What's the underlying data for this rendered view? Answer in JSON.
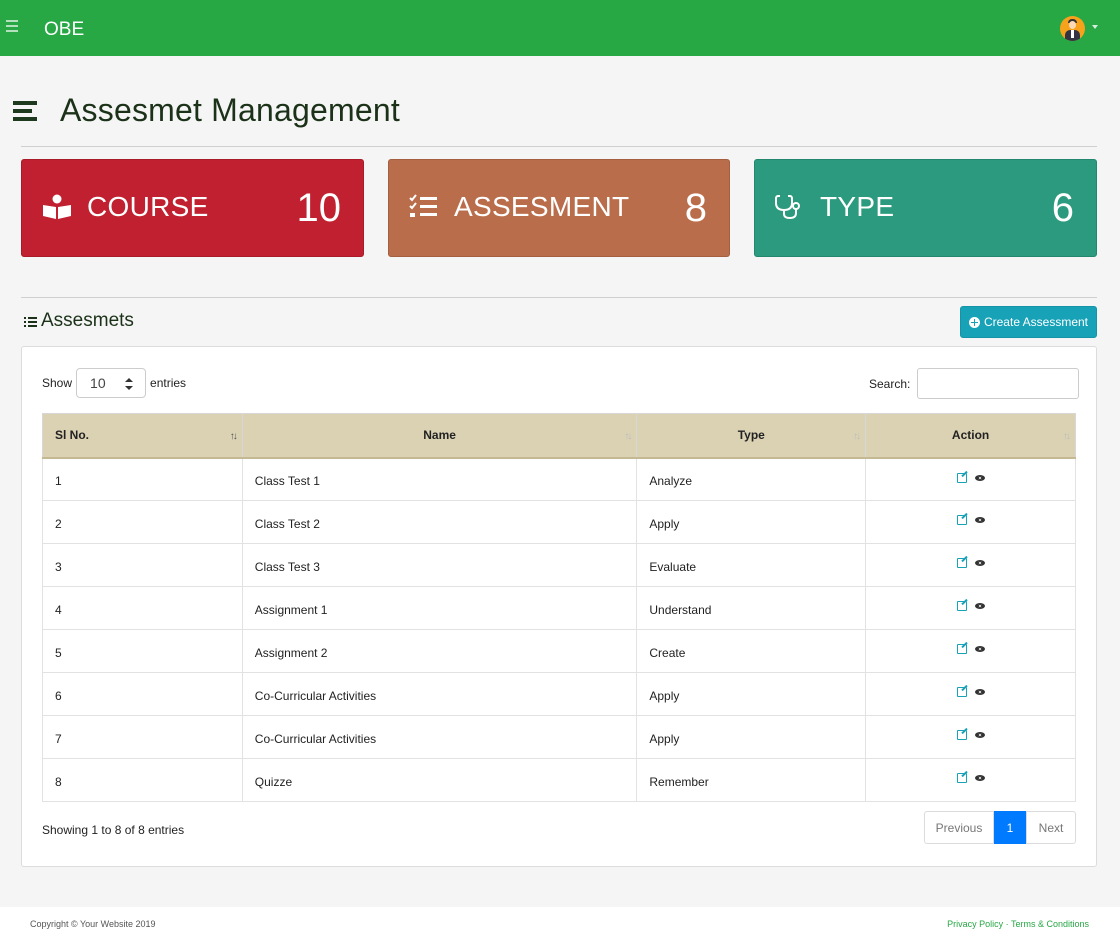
{
  "header": {
    "brand": "OBE",
    "menu_icon": "hamburger-icon",
    "avatar_icon": "user-avatar-icon"
  },
  "page": {
    "title": "Assesmet Management",
    "title_icon": "bars-icon"
  },
  "cards": [
    {
      "label": "COURSE",
      "count": "10",
      "icon": "book-reader-icon",
      "color": "#c0202f"
    },
    {
      "label": "ASSESMENT",
      "count": "8",
      "icon": "tasks-icon",
      "color": "#b96d4b"
    },
    {
      "label": "TYPE",
      "count": "6",
      "icon": "stethoscope-icon",
      "color": "#2b9a7e"
    }
  ],
  "section": {
    "title": "Assesmets",
    "icon": "list-icon",
    "create_button": "Create Assessment"
  },
  "datatable": {
    "show_label": "Show",
    "entries_value": "10",
    "entries_label": "entries",
    "search_label": "Search:",
    "search_value": "",
    "columns": [
      "Sl No.",
      "Name",
      "Type",
      "Action"
    ],
    "rows": [
      {
        "sl": "1",
        "name": "Class Test 1",
        "type": "Analyze"
      },
      {
        "sl": "2",
        "name": "Class Test 2",
        "type": "Apply"
      },
      {
        "sl": "3",
        "name": "Class Test 3",
        "type": "Evaluate"
      },
      {
        "sl": "4",
        "name": "Assignment 1",
        "type": "Understand"
      },
      {
        "sl": "5",
        "name": "Assignment 2",
        "type": "Create"
      },
      {
        "sl": "6",
        "name": "Co-Curricular Activities",
        "type": "Apply"
      },
      {
        "sl": "7",
        "name": "Co-Curricular Activities",
        "type": "Apply"
      },
      {
        "sl": "8",
        "name": "Quizze",
        "type": "Remember"
      }
    ],
    "info": "Showing 1 to 8 of 8 entries",
    "pagination": {
      "previous": "Previous",
      "current": "1",
      "next": "Next"
    }
  },
  "footer": {
    "copyright": "Copyright © Your Website 2019",
    "privacy": "Privacy Policy",
    "separator": "·",
    "terms": "Terms & Conditions",
    "link_color": "#28a745"
  },
  "colors": {
    "navbar": "#28a745",
    "accent": "#17a2b8",
    "pager_active": "#007bff",
    "table_header": "#dbd2b4"
  }
}
